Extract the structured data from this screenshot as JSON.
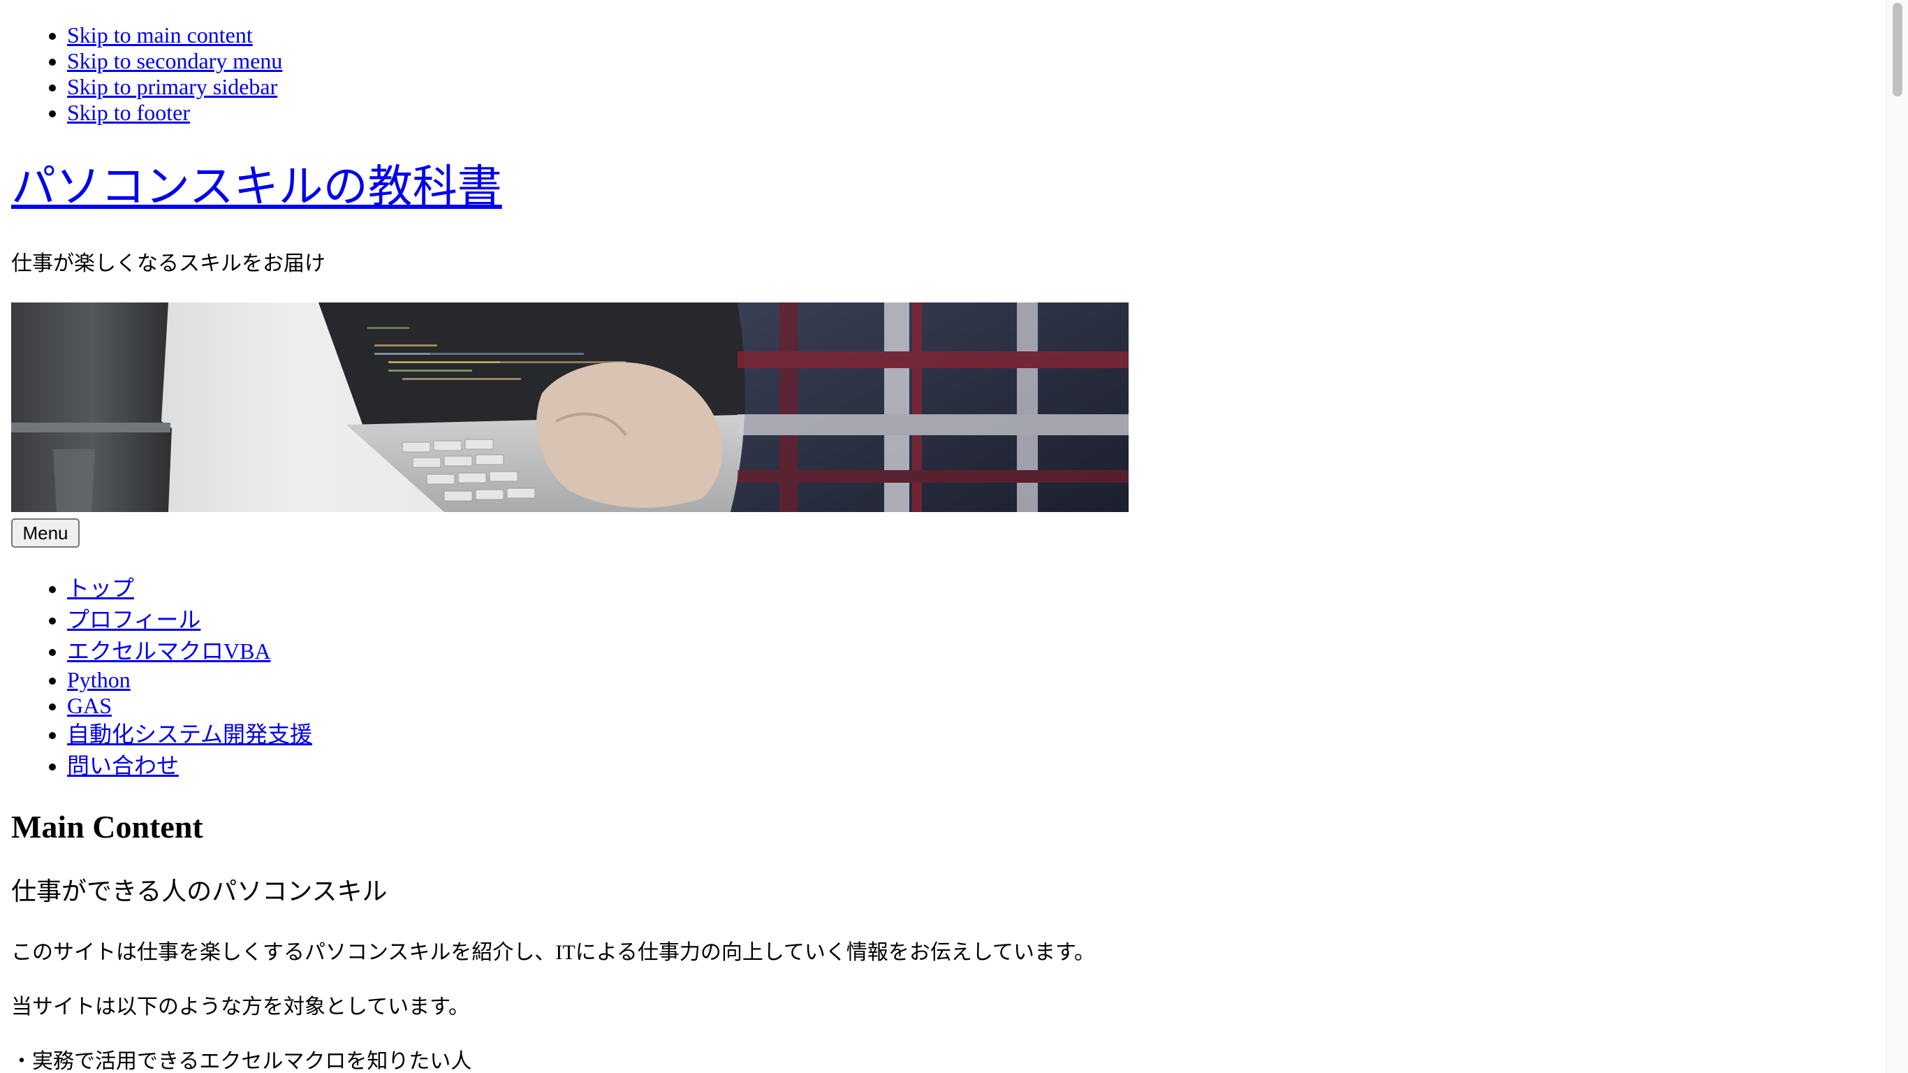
{
  "skip_links": [
    "Skip to main content",
    "Skip to secondary menu",
    "Skip to primary sidebar",
    "Skip to footer"
  ],
  "site": {
    "title": "パソコンスキルの教科書",
    "tagline": "仕事が楽しくなるスキルをお届け"
  },
  "header_image": {
    "subject": "hands typing on a laptop showing code, plaid shirt sleeve"
  },
  "menu_button": "Menu",
  "nav": [
    "トップ",
    "プロフィール",
    "エクセルマクロVBA",
    "Python",
    "GAS",
    "自動化システム開発支援",
    "問い合わせ"
  ],
  "main": {
    "heading": "Main Content",
    "section_title": "仕事ができる人のパソコンスキル",
    "paragraphs": [
      "このサイトは仕事を楽しくするパソコンスキルを紹介し、ITによる仕事力の向上していく情報をお伝えしています。",
      "当サイトは以下のような方を対象としています。",
      "・実務で活用できるエクセルマクロを知りたい人"
    ]
  },
  "colors": {
    "link": "#0000ee",
    "text": "#000000",
    "background": "#ffffff"
  }
}
